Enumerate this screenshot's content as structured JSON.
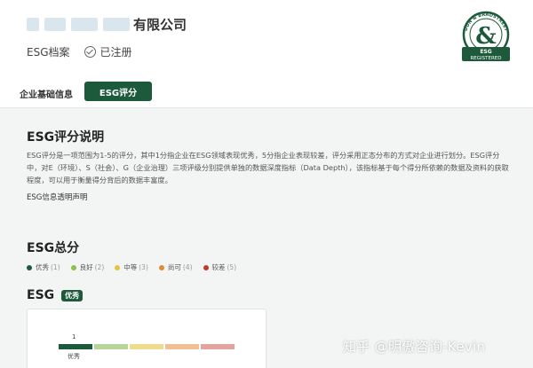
{
  "header": {
    "company_suffix": "有限公司",
    "profile_label": "ESG档案",
    "registered_status": "已注册"
  },
  "badge": {
    "arc_text": "DUN & BRADSTREET",
    "line1": "ESG",
    "line2": "REGISTERED",
    "color": "#1d5a3b"
  },
  "tabs": {
    "info": "企业基础信息",
    "esg": "ESG评分"
  },
  "score_explain": {
    "title": "ESG评分说明",
    "text": "ESG评分是一项范围为1-5的评分，其中1分指企业在ESG领域表现优秀，5分指企业表现较差，评分采用正态分布的方式对企业进行划分。ESG评分中，对E（环境）、S（社会）、G（企业治理）三项评级分别提供单独的数据深度指标（Data Depth），该指标基于每个得分所依赖的数据及资料的获取程度，可以用于衡量得分背后的数据丰富度。",
    "link": "ESG信息透明声明"
  },
  "total": {
    "title": "ESG总分",
    "legend": [
      {
        "label": "优秀",
        "level": "(1)",
        "color": "#1d5a3b"
      },
      {
        "label": "良好",
        "level": "(2)",
        "color": "#8bbf4e"
      },
      {
        "label": "中等",
        "level": "(3)",
        "color": "#e7c53b"
      },
      {
        "label": "尚可",
        "level": "(4)",
        "color": "#e08a34"
      },
      {
        "label": "较差",
        "level": "(5)",
        "color": "#c0392b"
      }
    ]
  },
  "esg": {
    "label": "ESG",
    "rating_pill": "优秀",
    "score": "1",
    "caption": "优秀"
  },
  "watermark": "知乎 @明傲咨询-Kevin"
}
